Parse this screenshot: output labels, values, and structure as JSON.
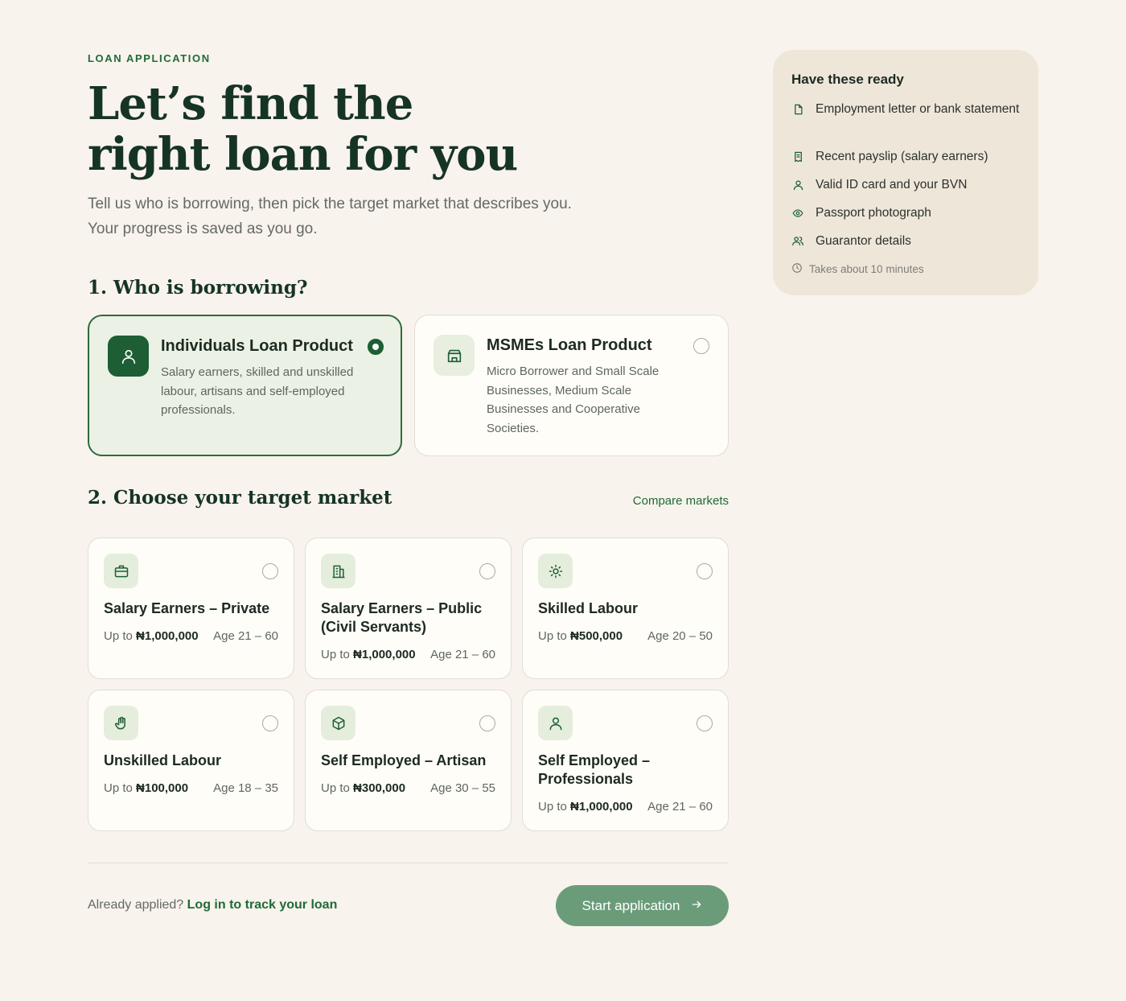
{
  "header": {
    "eyebrow": "LOAN APPLICATION",
    "title_line1": "Let’s find the",
    "title_line2": "right loan for you",
    "subtitle_line1": "Tell us who is borrowing, then pick the target market that describes you.",
    "subtitle_line2": "Your progress is saved as you go."
  },
  "borrower": {
    "heading": "1. Who is borrowing?",
    "options": [
      {
        "title": "Individuals Loan Product",
        "description": "Salary earners, skilled and unskilled labour, artisans and self-employed professionals.",
        "icon": "person-icon",
        "selected": true
      },
      {
        "title": "MSMEs Loan Product",
        "description": "Micro Borrower and Small Scale Businesses, Medium Scale Businesses and Cooperative Societies.",
        "icon": "storefront-icon",
        "selected": false
      }
    ]
  },
  "market": {
    "heading": "2. Choose your target market",
    "compare_label": "Compare markets",
    "up_to_label": "Up to",
    "items": [
      {
        "title": "Salary Earners – Private",
        "amount": "₦1,000,000",
        "age": "Age 21 – 60",
        "icon": "briefcase-icon"
      },
      {
        "title": "Salary Earners – Public (Civil Servants)",
        "amount": "₦1,000,000",
        "age": "Age 21 – 60",
        "icon": "building-icon"
      },
      {
        "title": "Skilled Labour",
        "amount": "₦500,000",
        "age": "Age 20 – 50",
        "icon": "sun-gear-icon"
      },
      {
        "title": "Unskilled Labour",
        "amount": "₦100,000",
        "age": "Age 18 – 35",
        "icon": "hand-icon"
      },
      {
        "title": "Self Employed – Artisan",
        "amount": "₦300,000",
        "age": "Age 30 – 55",
        "icon": "box-icon"
      },
      {
        "title": "Self Employed – Professionals",
        "amount": "₦1,000,000",
        "age": "Age 21 – 60",
        "icon": "person-icon"
      }
    ]
  },
  "footer": {
    "already_applied": "Already applied?",
    "login_link": "Log in to track your loan",
    "start_button": "Start application"
  },
  "requirements": {
    "title": "Have these ready",
    "items": [
      {
        "text": "Employment letter or bank statement",
        "icon": "document-icon"
      },
      {
        "text": "Recent payslip (salary earners)",
        "icon": "receipt-icon"
      },
      {
        "text": "Valid ID card and your BVN",
        "icon": "person-icon"
      },
      {
        "text": "Passport photograph",
        "icon": "eye-icon"
      },
      {
        "text": "Guarantor details",
        "icon": "people-icon"
      }
    ],
    "duration": "Takes about 10 minutes"
  },
  "colors": {
    "primary": "#1d5e34",
    "accent_text": "#1e6b37",
    "button": "#6b9c7a",
    "background": "#f8f3ec",
    "aside_bg": "#efe6da"
  }
}
